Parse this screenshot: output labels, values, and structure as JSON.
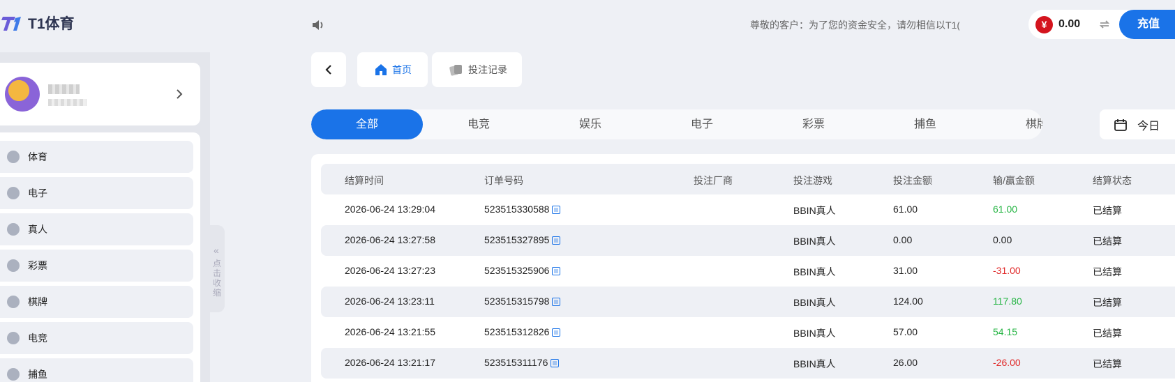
{
  "header": {
    "logo_text": "T1体育",
    "notice": "尊敬的客户：为了您的资金安全，请勿相信以T1(",
    "balance": "0.00",
    "recharge_label": "充值",
    "currency_symbol": "¥"
  },
  "sidebar": {
    "collapse_label": "点击收缩",
    "items": [
      {
        "label": "体育",
        "icon": "soccer-ball-icon"
      },
      {
        "label": "电子",
        "icon": "slot-machine-icon"
      },
      {
        "label": "真人",
        "icon": "poker-chip-icon"
      },
      {
        "label": "彩票",
        "icon": "lottery-ball-icon"
      },
      {
        "label": "棋牌",
        "icon": "cards-icon"
      },
      {
        "label": "电竞",
        "icon": "gamepad-icon"
      },
      {
        "label": "捕鱼",
        "icon": "fish-icon"
      }
    ]
  },
  "nav": {
    "tabs": [
      {
        "label": "首页",
        "icon": "home-icon"
      },
      {
        "label": "投注记录",
        "icon": "cards-icon"
      }
    ]
  },
  "categories": [
    "全部",
    "电竞",
    "娱乐",
    "电子",
    "彩票",
    "捕鱼",
    "棋牌"
  ],
  "date_filter": "今日",
  "table": {
    "headers": [
      "结算时间",
      "订单号码",
      "投注厂商",
      "投注游戏",
      "投注金额",
      "输/赢金额",
      "结算状态"
    ],
    "rows": [
      {
        "time": "2026-06-24 13:29:04",
        "order": "523515330588",
        "vendor": "",
        "game": "BBIN真人",
        "bet": "61.00",
        "win": "61.00",
        "status": "已结算"
      },
      {
        "time": "2026-06-24 13:27:58",
        "order": "523515327895",
        "vendor": "",
        "game": "BBIN真人",
        "bet": "0.00",
        "win": "0.00",
        "status": "已结算"
      },
      {
        "time": "2026-06-24 13:27:23",
        "order": "523515325906",
        "vendor": "",
        "game": "BBIN真人",
        "bet": "31.00",
        "win": "-31.00",
        "status": "已结算"
      },
      {
        "time": "2026-06-24 13:23:11",
        "order": "523515315798",
        "vendor": "",
        "game": "BBIN真人",
        "bet": "124.00",
        "win": "117.80",
        "status": "已结算"
      },
      {
        "time": "2026-06-24 13:21:55",
        "order": "523515312826",
        "vendor": "",
        "game": "BBIN真人",
        "bet": "57.00",
        "win": "54.15",
        "status": "已结算"
      },
      {
        "time": "2026-06-24 13:21:17",
        "order": "523515311176",
        "vendor": "",
        "game": "BBIN真人",
        "bet": "26.00",
        "win": "-26.00",
        "status": "已结算"
      }
    ]
  },
  "colors": {
    "accent": "#1a73e8",
    "positive": "#27b545",
    "negative": "#e02828"
  }
}
